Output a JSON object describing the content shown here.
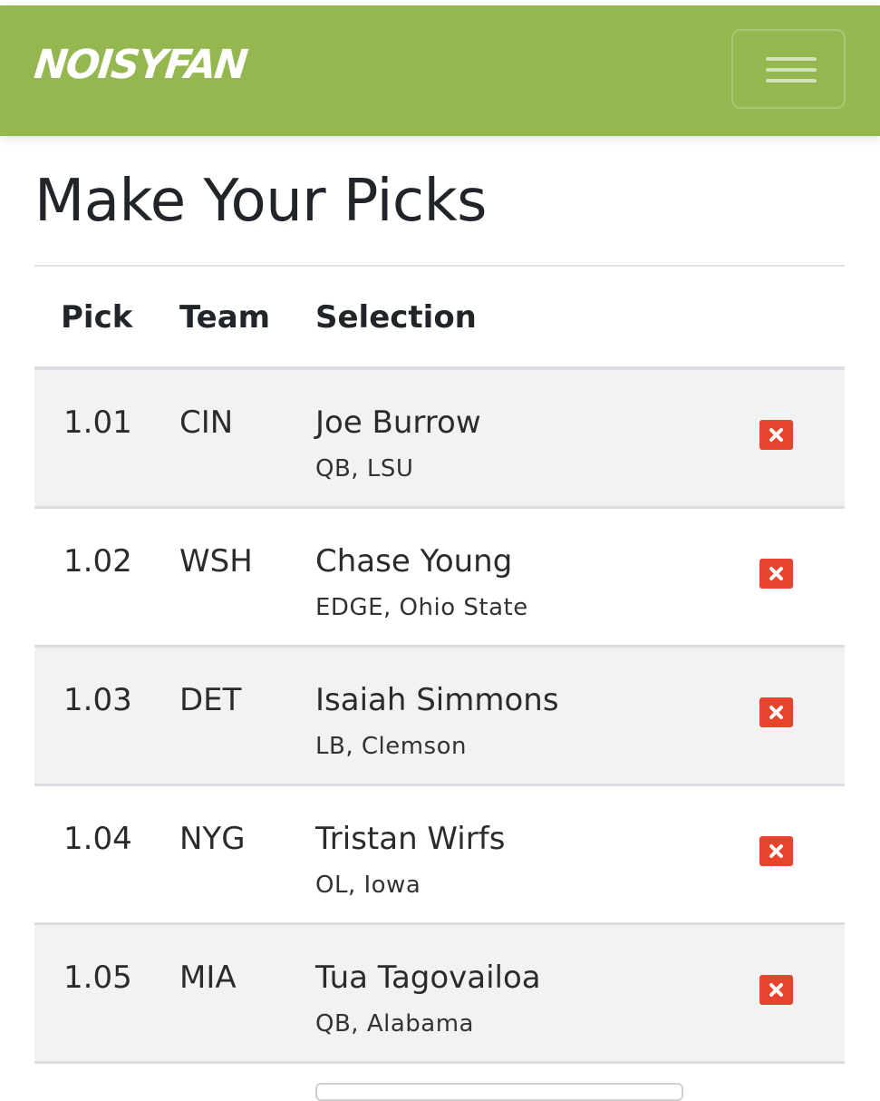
{
  "header": {
    "brand": "NOISYFAN",
    "menu_icon": "hamburger-icon",
    "color": "#94b74f"
  },
  "page": {
    "title": "Make Your Picks"
  },
  "table": {
    "columns": [
      "Pick",
      "Team",
      "Selection"
    ],
    "rows": [
      {
        "pick": "1.01",
        "team": "CIN",
        "name": "Joe Burrow",
        "detail": "QB, LSU"
      },
      {
        "pick": "1.02",
        "team": "WSH",
        "name": "Chase Young",
        "detail": "EDGE, Ohio State"
      },
      {
        "pick": "1.03",
        "team": "DET",
        "name": "Isaiah Simmons",
        "detail": "LB, Clemson"
      },
      {
        "pick": "1.04",
        "team": "NYG",
        "name": "Tristan Wirfs",
        "detail": "OL, Iowa"
      },
      {
        "pick": "1.05",
        "team": "MIA",
        "name": "Tua Tagovailoa",
        "detail": "QB, Alabama"
      }
    ],
    "remove_icon": "close-icon",
    "remove_color": "#e8432c"
  }
}
